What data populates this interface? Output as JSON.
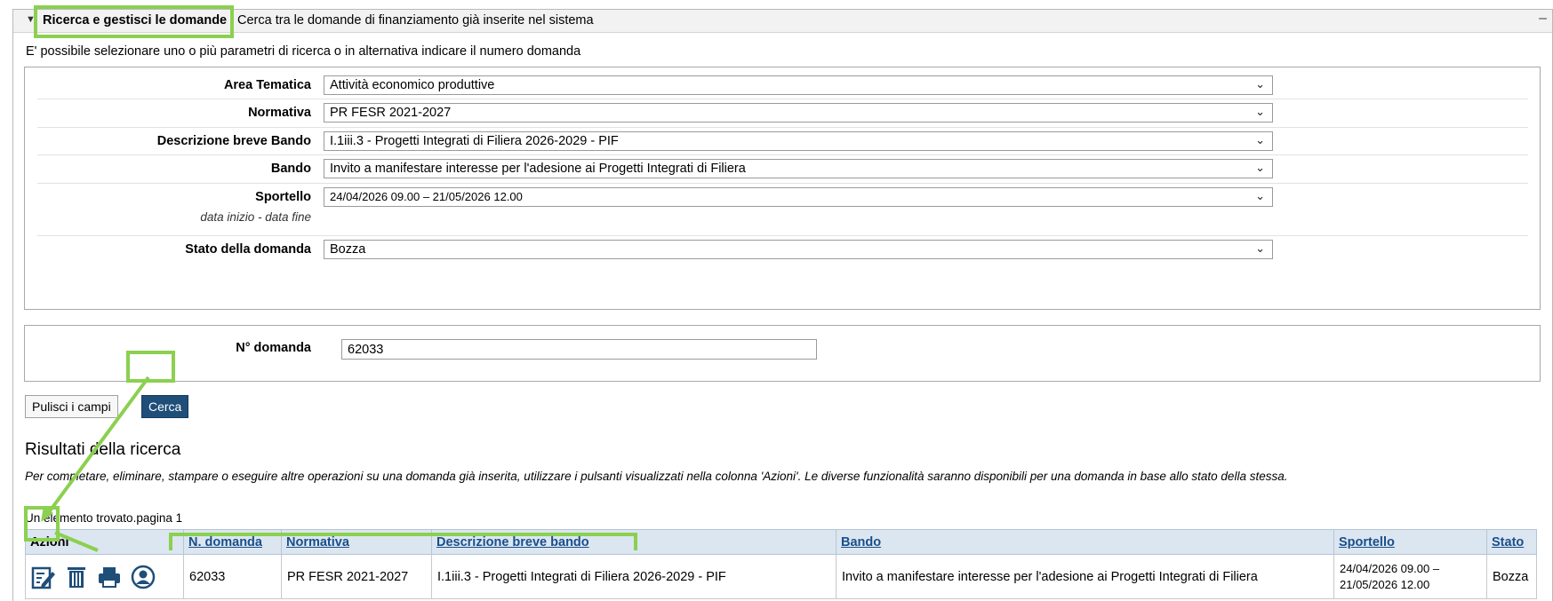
{
  "panel": {
    "title": "Ricerca e gestisci le domande",
    "subtitle": "Cerca tra le domande di finanziamento già inserite nel sistema",
    "intro": "E' possibile selezionare uno o più parametri di ricerca o in alternativa indicare il numero domanda"
  },
  "filters": {
    "area_tematica": {
      "label": "Area Tematica",
      "value": "Attività economico produttive"
    },
    "normativa": {
      "label": "Normativa",
      "value": "PR FESR 2021-2027"
    },
    "descrizione": {
      "label": "Descrizione breve Bando",
      "value": "I.1iii.3 - Progetti Integrati di Filiera 2026-2029 - PIF"
    },
    "bando": {
      "label": "Bando",
      "value": "Invito a manifestare interesse per l'adesione ai Progetti Integrati di Filiera"
    },
    "sportello": {
      "label": "Sportello",
      "sublabel": "data inizio - data fine",
      "value": "24/04/2026 09.00 – 21/05/2026 12.00"
    },
    "stato": {
      "label": "Stato della domanda",
      "value": "Bozza"
    }
  },
  "numero": {
    "label": "N° domanda",
    "value": "62033"
  },
  "buttons": {
    "clear": "Pulisci i campi",
    "search": "Cerca"
  },
  "results": {
    "title": "Risultati della ricerca",
    "description": "Per completare, eliminare, stampare o eseguire altre operazioni su una domanda già inserita, utilizzare i pulsanti visualizzati nella colonna 'Azioni'. Le diverse funzionalità saranno disponibili per una domanda in base allo stato della stessa.",
    "count": "Un elemento trovato.pagina 1",
    "headers": {
      "azioni": "Azioni",
      "numero": "N. domanda",
      "normativa": "Normativa",
      "descrizione": "Descrizione breve bando",
      "bando": "Bando",
      "sportello": "Sportello",
      "stato": "Stato"
    },
    "rows": [
      {
        "numero": "62033",
        "normativa": "PR FESR 2021-2027",
        "descrizione": "I.1iii.3 - Progetti Integrati di Filiera 2026-2029 - PIF",
        "bando": "Invito a manifestare interesse per l'adesione ai Progetti Integrati di Filiera",
        "sportello_start": "24/04/2026 09.00 –",
        "sportello_end": "21/05/2026 12.00",
        "stato": "Bozza"
      }
    ]
  },
  "icons": [
    "edit-icon",
    "delete-icon",
    "print-icon",
    "user-icon"
  ],
  "colors": {
    "highlight": "#8bd04f",
    "primary_button": "#1f4e79",
    "link": "#1a4f8b",
    "table_header": "#dce6f1"
  }
}
